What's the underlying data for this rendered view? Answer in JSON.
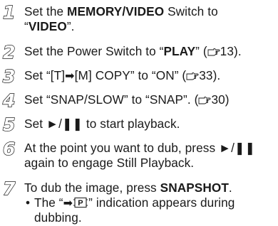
{
  "steps": [
    {
      "num": "1",
      "lines": [
        {
          "a": "Set the ",
          "b": "MEMORY/VIDEO",
          "c": " Switch to"
        },
        {
          "a": "“",
          "b": "VIDEO",
          "c": "”."
        }
      ]
    },
    {
      "num": "2",
      "lines": [
        {
          "a": "Set the Power Switch to “",
          "b": "PLAY",
          "c": "” (",
          "ref": "13",
          "d": ")."
        }
      ]
    },
    {
      "num": "3",
      "lines": [
        {
          "a": "Set “[T]",
          "arrow": "➡",
          "c": "[M] COPY” to “ON” (",
          "ref": "33",
          "d": ")."
        }
      ]
    },
    {
      "num": "4",
      "lines": [
        {
          "a": "Set “SNAP/SLOW” to “SNAP”. (",
          "ref": "30",
          "d": ")"
        }
      ]
    },
    {
      "num": "5",
      "lines": [
        {
          "a": "Set ►/❚❚ to start playback."
        }
      ]
    },
    {
      "num": "6",
      "lines": [
        {
          "a": "At the point you want to dub, press ►/❚❚"
        },
        {
          "a": "again to engage Still Playback."
        }
      ]
    },
    {
      "num": "7",
      "lines": [
        {
          "a": "To dub the image, press ",
          "b": "SNAPSHOT",
          "c": "."
        }
      ],
      "bullet": {
        "mark": "•",
        "line1_a": "The “",
        "arrow": "➡",
        "icon": "P",
        "line1_b": "” indication appears during",
        "line2": "dubbing."
      }
    }
  ],
  "icons": {
    "reference": "pointing-hand-reference-icon",
    "playback_image": "p-in-frame-icon"
  }
}
